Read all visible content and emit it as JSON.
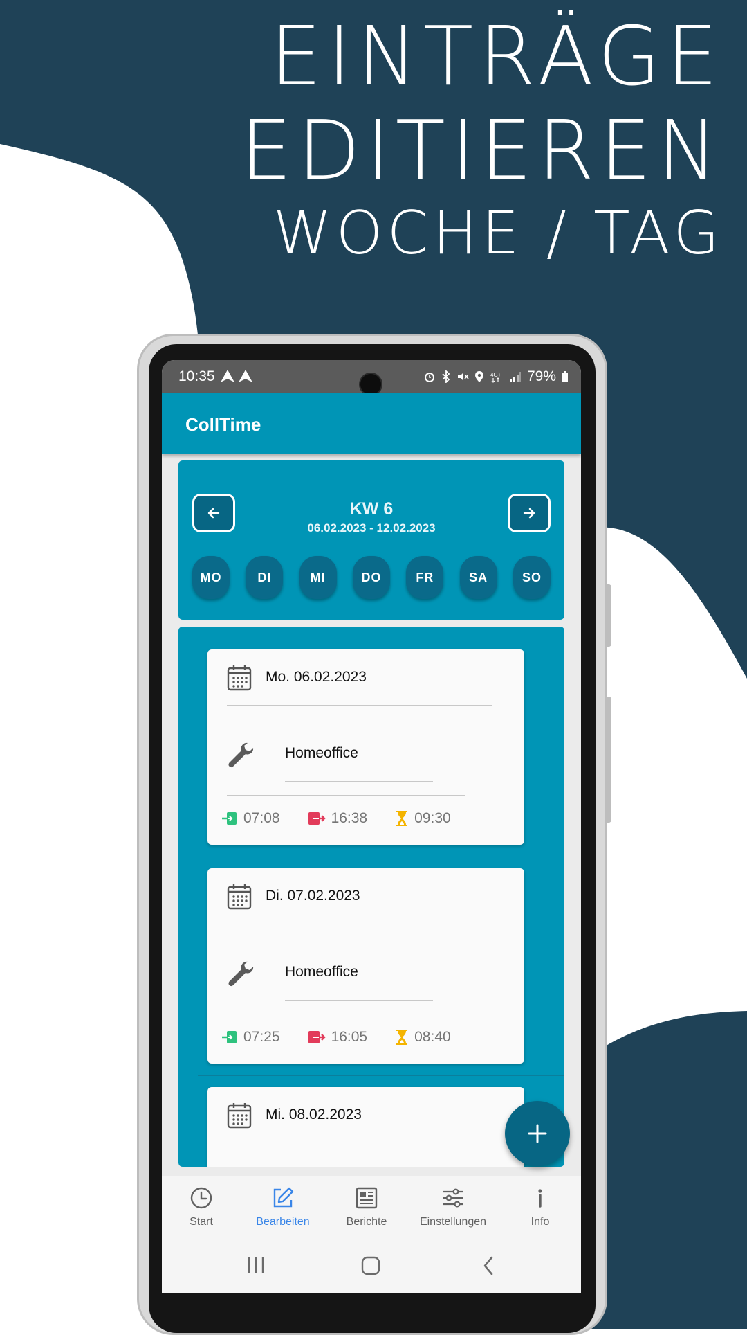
{
  "colors": {
    "navy": "#1f4257",
    "teal": "#0095b6",
    "dark_teal": "#076684",
    "active_nav": "#3a86e8",
    "green": "#2ec27e",
    "red": "#e23b5a",
    "amber": "#f4b400"
  },
  "headline": {
    "line1": "EINTRÄGE",
    "line2": "EDITIEREN",
    "line3": "WOCHE / TAG"
  },
  "statusbar": {
    "time": "10:35",
    "battery": "79%",
    "icons": [
      "alarm-icon",
      "bluetooth-icon",
      "mute-icon",
      "location-icon",
      "4g-icon",
      "signal-icon",
      "battery-icon"
    ]
  },
  "app": {
    "title": "CollTime"
  },
  "week": {
    "title": "KW 6",
    "range": "06.02.2023 - 12.02.2023",
    "days": [
      "MO",
      "DI",
      "MI",
      "DO",
      "FR",
      "SA",
      "SO"
    ]
  },
  "entries": [
    {
      "date": "Mo. 06.02.2023",
      "type": "Homeoffice",
      "start": "07:08",
      "end": "16:38",
      "duration": "09:30"
    },
    {
      "date": "Di. 07.02.2023",
      "type": "Homeoffice",
      "start": "07:25",
      "end": "16:05",
      "duration": "08:40"
    },
    {
      "date": "Mi. 08.02.2023"
    }
  ],
  "nav": {
    "start": "Start",
    "edit": "Bearbeiten",
    "reports": "Berichte",
    "settings": "Einstellungen",
    "info": "Info",
    "active": "Bearbeiten"
  }
}
